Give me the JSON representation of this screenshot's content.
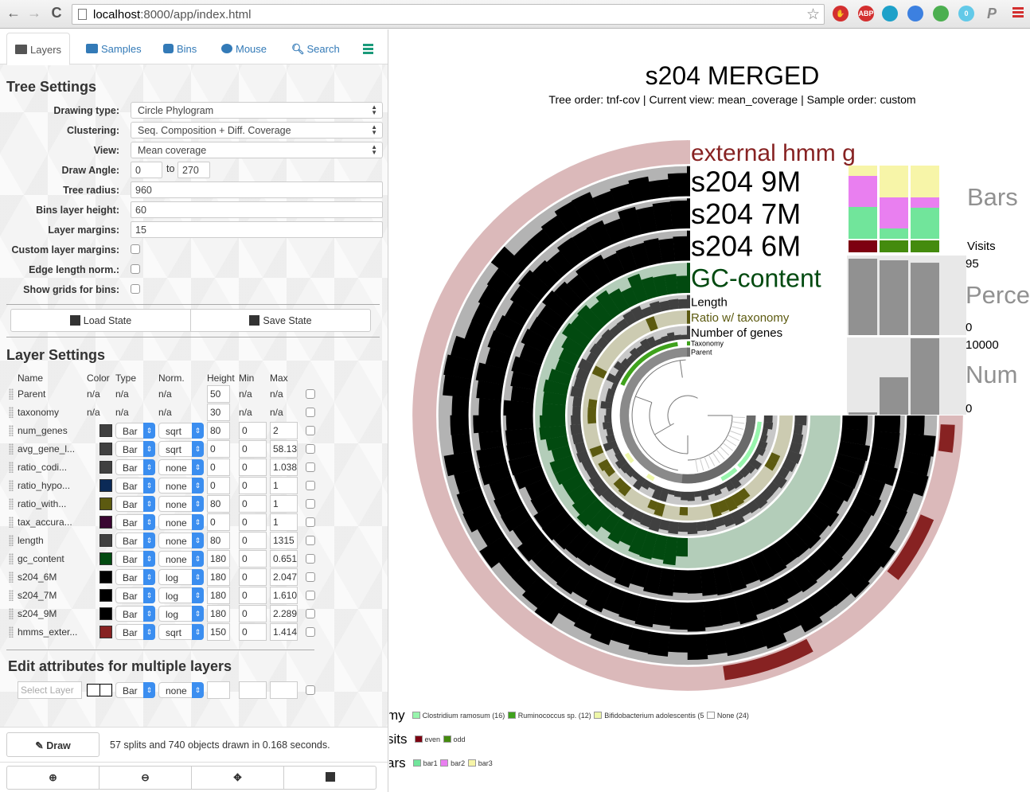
{
  "browser": {
    "url_host": "localhost",
    "url_rest": ":8000/app/index.html",
    "extensions": [
      {
        "name": "stop-hand-extension",
        "label": "✋",
        "color": "#d32f2f"
      },
      {
        "name": "adblock-plus-extension",
        "label": "ABP",
        "color": "#d32f2f"
      },
      {
        "name": "network-extension",
        "label": "",
        "color": "#1ea1c9"
      },
      {
        "name": "diamond-extension",
        "label": "",
        "color": "#3c80e0"
      },
      {
        "name": "green-bubble-extension",
        "label": "",
        "color": "#4caf50"
      },
      {
        "name": "ghostery-extension",
        "label": "0",
        "color": "#62c9e8"
      },
      {
        "name": "p-extension",
        "label": "P",
        "color": "#888888"
      }
    ]
  },
  "tabs": [
    {
      "label": "Layers",
      "icon": "image-icon",
      "active": true
    },
    {
      "label": "Samples",
      "icon": "briefcase-icon",
      "active": false
    },
    {
      "label": "Bins",
      "icon": "inbox-icon",
      "active": false
    },
    {
      "label": "Mouse",
      "icon": "eye-icon",
      "active": false
    },
    {
      "label": "Search",
      "icon": "search-icon",
      "active": false
    }
  ],
  "tree_settings": {
    "heading": "Tree Settings",
    "drawing_type_label": "Drawing type:",
    "drawing_type": "Circle Phylogram",
    "clustering_label": "Clustering:",
    "clustering": "Seq. Composition + Diff. Coverage",
    "view_label": "View:",
    "view": "Mean coverage",
    "draw_angle_label": "Draw Angle:",
    "angle_start": "0",
    "angle_to": "to",
    "angle_end": "270",
    "tree_radius_label": "Tree radius:",
    "tree_radius": "960",
    "bins_layer_height_label": "Bins layer height:",
    "bins_layer_height": "60",
    "layer_margins_label": "Layer margins:",
    "layer_margins": "15",
    "custom_layer_margins_label": "Custom layer margins:",
    "edge_length_norm_label": "Edge length norm.:",
    "show_grids_label": "Show grids for bins:",
    "load_state": "Load State",
    "save_state": "Save State"
  },
  "layer_settings": {
    "heading": "Layer Settings",
    "columns": [
      "Name",
      "Color",
      "Type",
      "Norm.",
      "Height",
      "Min",
      "Max"
    ],
    "rows": [
      {
        "name": "Parent",
        "color": null,
        "type": "n/a",
        "norm": "n/a",
        "height": "50",
        "min": "n/a",
        "max": "n/a"
      },
      {
        "name": "taxonomy",
        "color": null,
        "type": "n/a",
        "norm": "n/a",
        "height": "30",
        "min": "n/a",
        "max": "n/a"
      },
      {
        "name": "num_genes",
        "color": "#404040",
        "type": "Bar",
        "norm": "sqrt",
        "height": "80",
        "min": "0",
        "max": "2"
      },
      {
        "name": "avg_gene_l...",
        "color": "#404040",
        "type": "Bar",
        "norm": "sqrt",
        "height": "0",
        "min": "0",
        "max": "58.13"
      },
      {
        "name": "ratio_codi...",
        "color": "#404040",
        "type": "Bar",
        "norm": "none",
        "height": "0",
        "min": "0",
        "max": "1.038"
      },
      {
        "name": "ratio_hypo...",
        "color": "#0b2a57",
        "type": "Bar",
        "norm": "none",
        "height": "0",
        "min": "0",
        "max": "1"
      },
      {
        "name": "ratio_with...",
        "color": "#5c5a10",
        "type": "Bar",
        "norm": "none",
        "height": "80",
        "min": "0",
        "max": "1"
      },
      {
        "name": "tax_accura...",
        "color": "#3a0632",
        "type": "Bar",
        "norm": "none",
        "height": "0",
        "min": "0",
        "max": "1"
      },
      {
        "name": "length",
        "color": "#404040",
        "type": "Bar",
        "norm": "none",
        "height": "80",
        "min": "0",
        "max": "1315"
      },
      {
        "name": "gc_content",
        "color": "#024a10",
        "type": "Bar",
        "norm": "none",
        "height": "180",
        "min": "0",
        "max": "0.651"
      },
      {
        "name": "s204_6M",
        "color": "#000000",
        "type": "Bar",
        "norm": "log",
        "height": "180",
        "min": "0",
        "max": "2.047"
      },
      {
        "name": "s204_7M",
        "color": "#000000",
        "type": "Bar",
        "norm": "log",
        "height": "180",
        "min": "0",
        "max": "1.610"
      },
      {
        "name": "s204_9M",
        "color": "#000000",
        "type": "Bar",
        "norm": "log",
        "height": "180",
        "min": "0",
        "max": "2.289"
      },
      {
        "name": "hmms_exter...",
        "color": "#872222",
        "type": "Bar",
        "norm": "sqrt",
        "height": "150",
        "min": "0",
        "max": "1.414"
      }
    ]
  },
  "multi_edit": {
    "heading": "Edit attributes for multiple layers",
    "select_placeholder": "Select Layer",
    "type": "Bar",
    "norm": "none"
  },
  "draw": {
    "button": "Draw",
    "status": "57 splits and 740 objects drawn in 0.168 seconds."
  },
  "toolbar": [
    {
      "name": "zoom-in-button",
      "icon": "zoom-in-icon"
    },
    {
      "name": "zoom-out-button",
      "icon": "zoom-out-icon"
    },
    {
      "name": "center-button",
      "icon": "move-icon"
    },
    {
      "name": "save-svg-button",
      "icon": "save-icon"
    }
  ],
  "main": {
    "title": "s204 MERGED",
    "subtitle": "Tree order: tnf-cov | Current view: mean_coverage | Sample order: custom"
  },
  "chart_data": {
    "type": "circular-phylogram",
    "angle_range_deg": [
      0,
      270
    ],
    "leaves": 57,
    "layers_inner_to_outer": [
      {
        "label": "Parent",
        "color": "#707070"
      },
      {
        "label": "Taxonomy",
        "color": "#3fa21c"
      },
      {
        "label": "Number of genes",
        "color": "#404040"
      },
      {
        "label": "Ratio w/ taxonomy",
        "color": "#5c5a10"
      },
      {
        "label": "Length",
        "color": "#404040"
      },
      {
        "label": "GC-content",
        "color": "#024a10"
      },
      {
        "label": "s204 6M",
        "color": "#000000"
      },
      {
        "label": "s204 7M",
        "color": "#000000"
      },
      {
        "label": "s204 9M",
        "color": "#000000"
      },
      {
        "label": "external hmm g",
        "color": "#872222"
      }
    ],
    "sample_panel": {
      "samples": 3,
      "bars": {
        "title": "Bars",
        "legend": [
          {
            "label": "bar1",
            "color": "#71e59b"
          },
          {
            "label": "bar2",
            "color": "#e97ff0"
          },
          {
            "label": "bar3",
            "color": "#f7f5a8"
          }
        ],
        "stacks": [
          {
            "bar1": 0.4,
            "bar2": 0.39,
            "bar3": 0.13
          },
          {
            "bar1": 0.13,
            "bar2": 0.39,
            "bar3": 0.4
          },
          {
            "bar1": 0.39,
            "bar2": 0.13,
            "bar3": 0.4
          }
        ]
      },
      "visits": {
        "title": "Visits",
        "legend": [
          {
            "label": "even",
            "color": "#7d0011"
          },
          {
            "label": "odd",
            "color": "#448b0e"
          }
        ],
        "values": [
          "even",
          "odd",
          "odd"
        ]
      },
      "percent": {
        "title": "Perce",
        "max": 95,
        "min": 0,
        "values": [
          95,
          93,
          90
        ]
      },
      "num": {
        "title": "Num",
        "max": 10000,
        "min": 0,
        "values": [
          300,
          4900,
          10000
        ]
      }
    },
    "legends": [
      {
        "title": "my",
        "items": [
          {
            "label": "Clostridium ramosum (16)",
            "color": "#98f5ad"
          },
          {
            "label": "Ruminococcus sp. (12)",
            "color": "#3fa21c"
          },
          {
            "label": "Bifidobacterium adolescentis (5",
            "color": "#eef7a9"
          },
          {
            "label": "None (24)",
            "color": "#ffffff"
          }
        ]
      },
      {
        "title": "sits",
        "items": [
          {
            "label": "even",
            "color": "#7d0011"
          },
          {
            "label": "odd",
            "color": "#448b0e"
          }
        ]
      },
      {
        "title": "ars",
        "items": [
          {
            "label": "bar1",
            "color": "#71e59b"
          },
          {
            "label": "bar2",
            "color": "#e97ff0"
          },
          {
            "label": "bar3",
            "color": "#f7f5a8"
          }
        ]
      }
    ]
  }
}
